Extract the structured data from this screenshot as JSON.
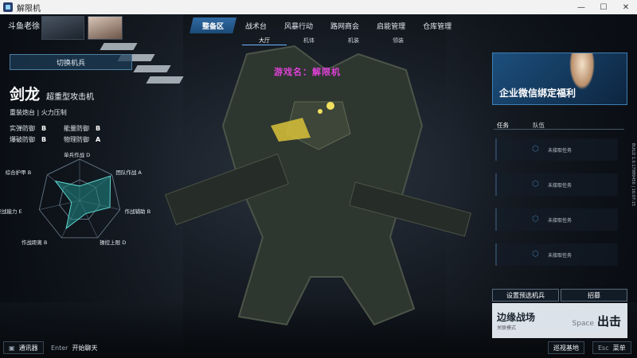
{
  "window": {
    "title": "解限机",
    "minimize": "—",
    "maximize": "☐",
    "close": "✕"
  },
  "player": {
    "name": "斗鱼老徐"
  },
  "nav": {
    "tabs": [
      "整备区",
      "战术台",
      "风暴行动",
      "路网商会",
      "启能管理",
      "仓库管理"
    ],
    "active_index": 0,
    "subtabs": [
      "大厅",
      "机体",
      "机装",
      "领装"
    ]
  },
  "left": {
    "switch_label": "切换机兵",
    "mech_name": "剑龙",
    "mech_class": "超重型攻击机",
    "tags": "重装炮台 | 火力压制",
    "stats": [
      {
        "label": "实弹防御",
        "grade": "B"
      },
      {
        "label": "能量防御",
        "grade": "B"
      },
      {
        "label": "爆破防御",
        "grade": "B"
      },
      {
        "label": "物理防御",
        "grade": "A"
      }
    ],
    "radar": [
      {
        "label": "单兵作战",
        "grade": "D"
      },
      {
        "label": "团队作战",
        "grade": "A"
      },
      {
        "label": "作战辅助",
        "grade": "B"
      },
      {
        "label": "操控上限",
        "grade": "D"
      },
      {
        "label": "作战距离",
        "grade": "B"
      },
      {
        "label": "空战能力",
        "grade": "E"
      },
      {
        "label": "综合护甲",
        "grade": "B"
      }
    ],
    "radar_values": [
      0.35,
      0.95,
      0.75,
      0.35,
      0.75,
      0.2,
      0.75
    ]
  },
  "overlay": {
    "text": "游戏名：解限机"
  },
  "right": {
    "banner_text": "企业微信绑定福利",
    "tabs": [
      "任务",
      "队伍"
    ],
    "tasks": [
      "未接取任务",
      "未接取任务",
      "未接取任务",
      "未接取任务"
    ],
    "side_text": "BUILD 1.0.17989456 | 16:07:15",
    "preset_label": "设置预选机兵",
    "recruit_label": "招募",
    "battle_mode": "边缘战场",
    "battle_sub": "关联模式",
    "battle_key": "Space",
    "battle_label": "出击"
  },
  "bottom": {
    "comm_label": "通讯器",
    "chat_key": "Enter",
    "chat_label": "开始聊天",
    "patrol_label": "巡视基地",
    "esc_key": "Esc",
    "esc_label": "菜单"
  },
  "colors": {
    "accent": "#2f6aa3",
    "overlay_text": "#e042d8",
    "radar_fill": "#1f8a86"
  }
}
